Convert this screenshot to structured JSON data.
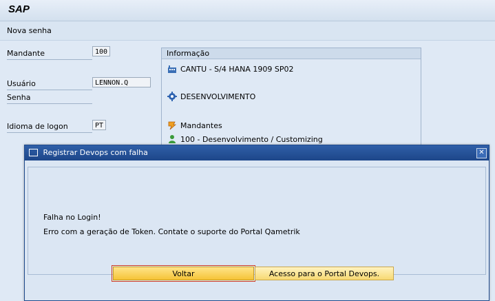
{
  "app": {
    "logo": "SAP",
    "screen_title": "Nova senha"
  },
  "login": {
    "client_label": "Mandante",
    "client_value": "100",
    "user_label": "Usuário",
    "user_value": "LENNON.Q",
    "password_label": "Senha",
    "language_label": "Idioma de logon",
    "language_value": "PT"
  },
  "info": {
    "title": "Informação",
    "system": "CANTU - S/4 HANA 1909 SP02",
    "environment": "DESENVOLVIMENTO",
    "clients_header": "Mandantes",
    "client_entry": "100 - Desenvolvimento / Customizing"
  },
  "dialog": {
    "title": "Registrar Devops com falha",
    "message_line1": "Falha no Login!",
    "message_line2": "Erro com a geração de Token. Contate o suporte do Portal Qametrik",
    "back_button": "Voltar",
    "portal_button": "Acesso para o Portal Devops."
  },
  "colors": {
    "title_bar": "#1d4689",
    "primary_button": "#f5c437",
    "background": "#dfe9f5"
  }
}
